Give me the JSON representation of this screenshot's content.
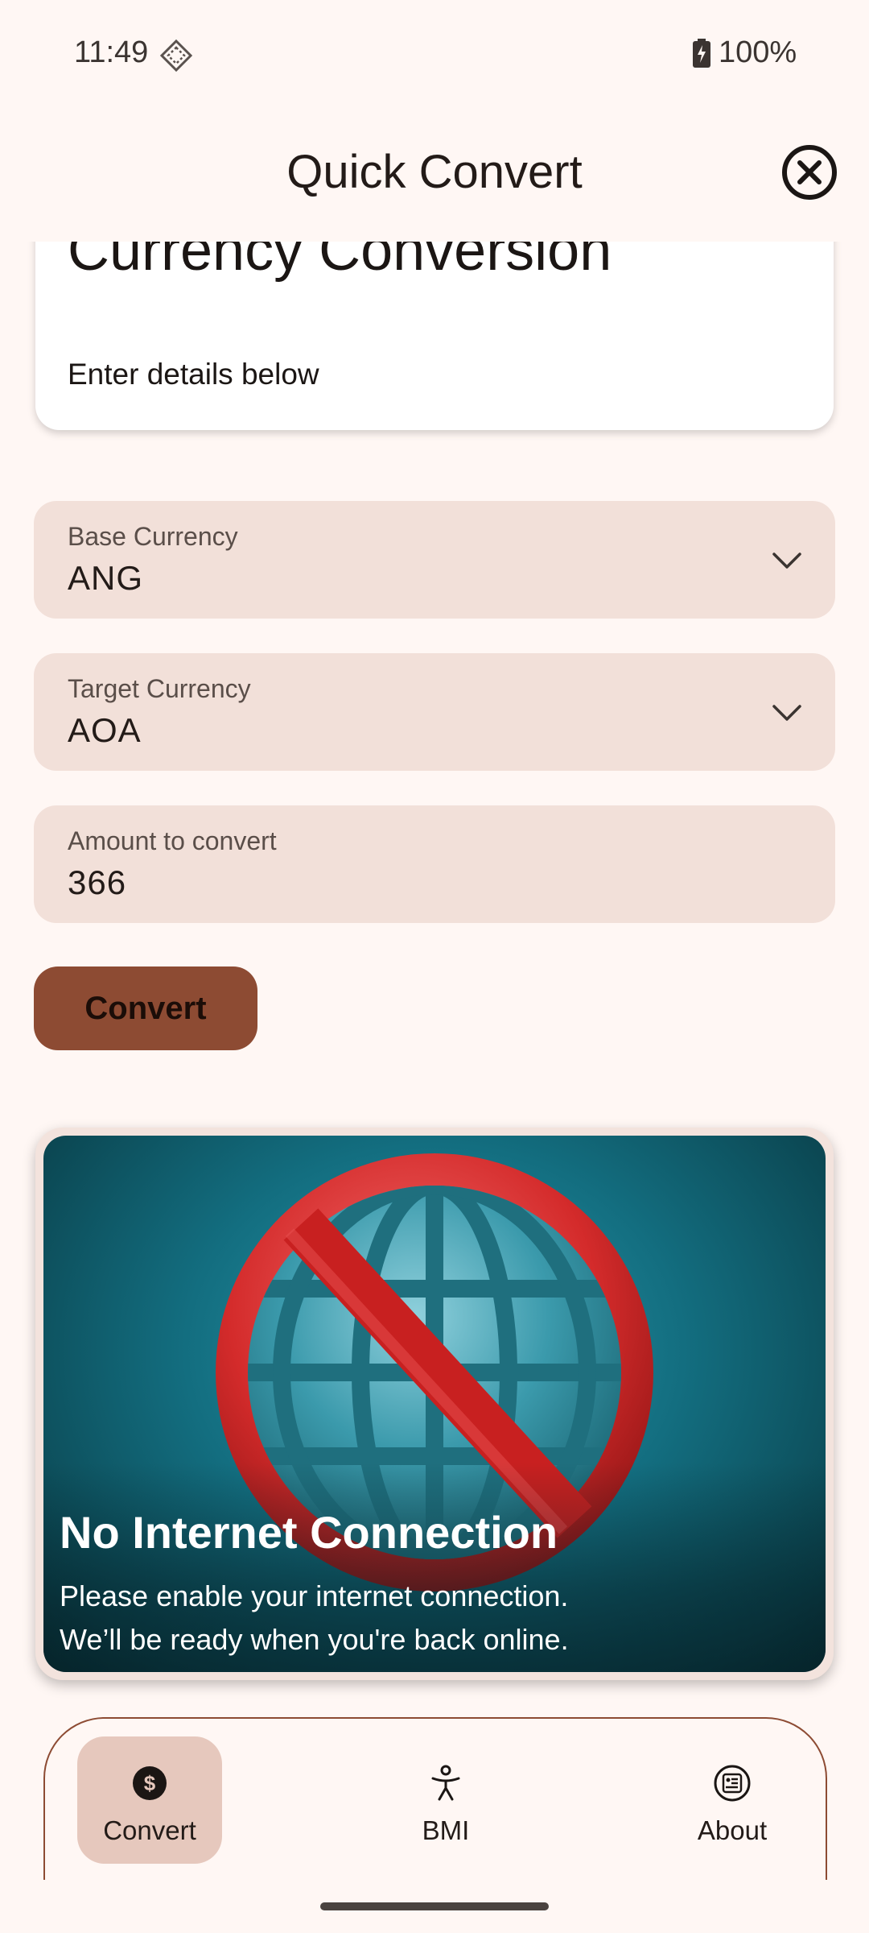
{
  "status_bar": {
    "time": "11:49",
    "battery": "100%"
  },
  "app_bar": {
    "title": "Quick Convert"
  },
  "header": {
    "title": "Currency Conversion",
    "subtitle": "Enter details below"
  },
  "form": {
    "base_currency": {
      "label": "Base Currency",
      "value": "ANG"
    },
    "target_currency": {
      "label": "Target Currency",
      "value": "AOA"
    },
    "amount": {
      "label": "Amount to convert",
      "value": "366"
    },
    "convert_label": "Convert"
  },
  "offline_card": {
    "title": "No Internet Connection",
    "message_line1": "Please enable your internet connection.",
    "message_line2": "We’ll be ready when you're back online."
  },
  "bottom_nav": {
    "items": [
      {
        "label": "Convert",
        "icon": "dollar-circle-icon",
        "active": true
      },
      {
        "label": "BMI",
        "icon": "person-icon",
        "active": false
      },
      {
        "label": "About",
        "icon": "info-card-icon",
        "active": false
      }
    ]
  },
  "colors": {
    "background": "#FFF7F4",
    "field": "#F2E0D9",
    "accent": "#8D4B33",
    "active_nav": "#E6C8BD"
  }
}
